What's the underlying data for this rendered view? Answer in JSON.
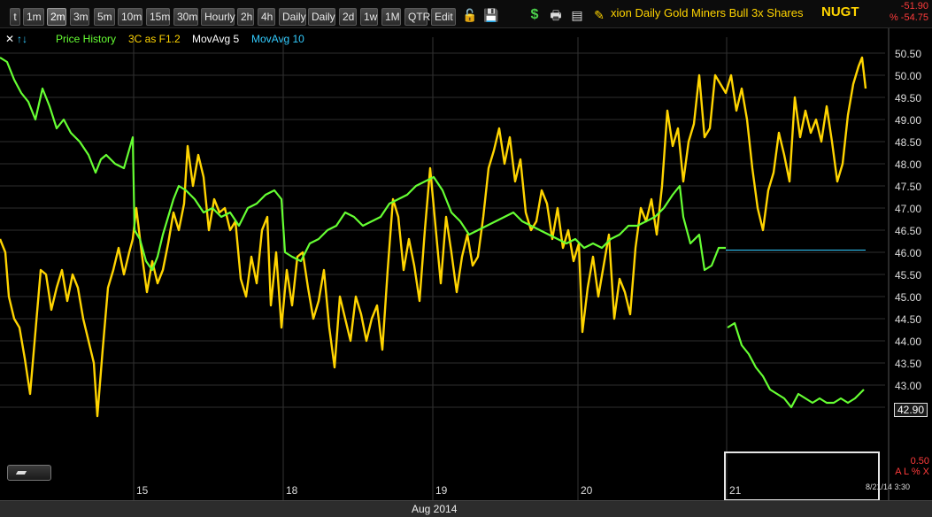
{
  "toolbar": {
    "buttons": [
      "t",
      "1m",
      "2m",
      "3m",
      "5m",
      "10m",
      "15m",
      "30m",
      "Hourly",
      "2h",
      "4h",
      "Daily",
      "Daily",
      "2d",
      "1w",
      "1M",
      "QTR",
      "Edit"
    ],
    "active": "2m",
    "icons": [
      "lock-icon",
      "save-icon",
      "dollar-icon",
      "print-icon",
      "data-window-icon",
      "pencil-icon"
    ],
    "title": "xion Daily Gold Miners Bull 3x Shares",
    "symbol": "NUGT",
    "change_abs": "-51.90",
    "change_pct": "% -54.75"
  },
  "legend": {
    "arrows": "↑↓",
    "items": [
      "Price History",
      "3C as F1.2",
      "MovAvg 5",
      "MovAvg 10"
    ],
    "colors": [
      "#66ff33",
      "#ffd400",
      "#ffffff",
      "#33ccff"
    ]
  },
  "bottom": {
    "month_label": "Aug 2014",
    "timestamp": "8/21/14 3:30",
    "small_value": "0.50",
    "small_controls": "A L % X",
    "last_price": "42.90"
  },
  "chart_data": {
    "type": "line",
    "x_labels": [
      "15",
      "18",
      "19",
      "20",
      "21"
    ],
    "y_ticks": [
      50.5,
      50.0,
      49.5,
      49.0,
      48.5,
      48.0,
      47.5,
      47.0,
      46.5,
      46.0,
      45.5,
      45.0,
      44.5,
      44.0,
      43.5,
      43.0,
      42.5
    ],
    "ylim": [
      42.15,
      50.85
    ],
    "grid": true,
    "series": [
      {
        "name": "Price History",
        "color": "#66ff33",
        "points": [
          [
            0,
            50.4
          ],
          [
            8,
            50.3
          ],
          [
            16,
            49.9
          ],
          [
            24,
            49.6
          ],
          [
            32,
            49.4
          ],
          [
            40,
            49.0
          ],
          [
            48,
            49.7
          ],
          [
            56,
            49.3
          ],
          [
            64,
            48.8
          ],
          [
            72,
            49.0
          ],
          [
            80,
            48.7
          ],
          [
            90,
            48.5
          ],
          [
            100,
            48.2
          ],
          [
            108,
            47.8
          ],
          [
            114,
            48.1
          ],
          [
            120,
            48.2
          ],
          [
            130,
            48.0
          ],
          [
            140,
            47.9
          ],
          [
            150,
            48.6
          ],
          [
            152,
            46.5
          ],
          [
            158,
            46.3
          ],
          [
            165,
            45.8
          ],
          [
            172,
            45.6
          ],
          [
            178,
            45.9
          ],
          [
            184,
            46.4
          ],
          [
            190,
            46.8
          ],
          [
            196,
            47.2
          ],
          [
            202,
            47.5
          ],
          [
            210,
            47.4
          ],
          [
            220,
            47.2
          ],
          [
            230,
            46.9
          ],
          [
            240,
            47.0
          ],
          [
            250,
            46.8
          ],
          [
            260,
            46.9
          ],
          [
            270,
            46.6
          ],
          [
            280,
            47.0
          ],
          [
            290,
            47.1
          ],
          [
            300,
            47.3
          ],
          [
            310,
            47.4
          ],
          [
            318,
            47.2
          ],
          [
            322,
            46.0
          ],
          [
            330,
            45.9
          ],
          [
            340,
            45.8
          ],
          [
            350,
            46.2
          ],
          [
            360,
            46.3
          ],
          [
            370,
            46.5
          ],
          [
            380,
            46.6
          ],
          [
            390,
            46.9
          ],
          [
            400,
            46.8
          ],
          [
            410,
            46.6
          ],
          [
            420,
            46.7
          ],
          [
            430,
            46.8
          ],
          [
            440,
            47.1
          ],
          [
            450,
            47.2
          ],
          [
            460,
            47.3
          ],
          [
            470,
            47.5
          ],
          [
            480,
            47.6
          ],
          [
            490,
            47.7
          ],
          [
            500,
            47.4
          ],
          [
            510,
            46.9
          ],
          [
            520,
            46.7
          ],
          [
            530,
            46.4
          ],
          [
            540,
            46.5
          ],
          [
            550,
            46.6
          ],
          [
            560,
            46.7
          ],
          [
            570,
            46.8
          ],
          [
            580,
            46.9
          ],
          [
            590,
            46.7
          ],
          [
            600,
            46.6
          ],
          [
            610,
            46.5
          ],
          [
            620,
            46.4
          ],
          [
            630,
            46.3
          ],
          [
            640,
            46.2
          ],
          [
            650,
            46.3
          ],
          [
            660,
            46.1
          ],
          [
            670,
            46.2
          ],
          [
            680,
            46.1
          ],
          [
            690,
            46.3
          ],
          [
            700,
            46.4
          ],
          [
            710,
            46.6
          ],
          [
            720,
            46.6
          ],
          [
            730,
            46.7
          ],
          [
            740,
            46.8
          ],
          [
            750,
            47.0
          ],
          [
            760,
            47.3
          ],
          [
            768,
            47.5
          ],
          [
            772,
            46.8
          ],
          [
            780,
            46.2
          ],
          [
            790,
            46.4
          ],
          [
            796,
            45.6
          ],
          [
            804,
            45.7
          ],
          [
            812,
            46.1
          ],
          [
            820,
            46.1
          ],
          [
            822,
            44.3
          ],
          [
            830,
            44.4
          ],
          [
            838,
            43.9
          ],
          [
            846,
            43.7
          ],
          [
            854,
            43.4
          ],
          [
            862,
            43.2
          ],
          [
            870,
            42.9
          ],
          [
            878,
            42.8
          ],
          [
            886,
            42.7
          ],
          [
            894,
            42.5
          ],
          [
            902,
            42.8
          ],
          [
            910,
            42.7
          ],
          [
            918,
            42.6
          ],
          [
            926,
            42.7
          ],
          [
            934,
            42.6
          ],
          [
            942,
            42.6
          ],
          [
            950,
            42.7
          ],
          [
            958,
            42.6
          ],
          [
            966,
            42.7
          ],
          [
            976,
            42.9
          ]
        ]
      },
      {
        "name": "3C as F1.2",
        "color": "#ffd400",
        "points": [
          [
            0,
            46.3
          ],
          [
            6,
            46.0
          ],
          [
            10,
            45.0
          ],
          [
            16,
            44.5
          ],
          [
            22,
            44.3
          ],
          [
            28,
            43.6
          ],
          [
            34,
            42.8
          ],
          [
            40,
            44.2
          ],
          [
            46,
            45.6
          ],
          [
            52,
            45.5
          ],
          [
            58,
            44.7
          ],
          [
            64,
            45.2
          ],
          [
            70,
            45.6
          ],
          [
            76,
            44.9
          ],
          [
            82,
            45.5
          ],
          [
            88,
            45.2
          ],
          [
            94,
            44.5
          ],
          [
            100,
            44.0
          ],
          [
            106,
            43.5
          ],
          [
            110,
            42.3
          ],
          [
            116,
            43.8
          ],
          [
            122,
            45.2
          ],
          [
            128,
            45.6
          ],
          [
            134,
            46.1
          ],
          [
            140,
            45.5
          ],
          [
            146,
            46.0
          ],
          [
            150,
            46.3
          ],
          [
            154,
            47.0
          ],
          [
            160,
            46.0
          ],
          [
            166,
            45.1
          ],
          [
            172,
            45.8
          ],
          [
            178,
            45.3
          ],
          [
            184,
            45.6
          ],
          [
            190,
            46.2
          ],
          [
            196,
            46.9
          ],
          [
            202,
            46.5
          ],
          [
            208,
            47.1
          ],
          [
            212,
            48.4
          ],
          [
            218,
            47.5
          ],
          [
            224,
            48.2
          ],
          [
            230,
            47.7
          ],
          [
            236,
            46.5
          ],
          [
            242,
            47.2
          ],
          [
            248,
            46.9
          ],
          [
            254,
            47.0
          ],
          [
            260,
            46.5
          ],
          [
            266,
            46.7
          ],
          [
            272,
            45.4
          ],
          [
            278,
            45.0
          ],
          [
            284,
            45.9
          ],
          [
            290,
            45.3
          ],
          [
            296,
            46.5
          ],
          [
            302,
            46.8
          ],
          [
            306,
            44.8
          ],
          [
            312,
            46.0
          ],
          [
            318,
            44.3
          ],
          [
            324,
            45.6
          ],
          [
            330,
            44.8
          ],
          [
            336,
            45.9
          ],
          [
            342,
            46.0
          ],
          [
            348,
            45.2
          ],
          [
            354,
            44.5
          ],
          [
            360,
            44.9
          ],
          [
            366,
            45.6
          ],
          [
            372,
            44.3
          ],
          [
            378,
            43.4
          ],
          [
            384,
            45.0
          ],
          [
            390,
            44.5
          ],
          [
            396,
            44.0
          ],
          [
            402,
            45.0
          ],
          [
            408,
            44.6
          ],
          [
            414,
            44.0
          ],
          [
            420,
            44.5
          ],
          [
            426,
            44.8
          ],
          [
            432,
            43.8
          ],
          [
            438,
            45.6
          ],
          [
            444,
            47.2
          ],
          [
            450,
            46.8
          ],
          [
            456,
            45.6
          ],
          [
            462,
            46.3
          ],
          [
            468,
            45.7
          ],
          [
            474,
            44.9
          ],
          [
            480,
            46.5
          ],
          [
            486,
            47.9
          ],
          [
            492,
            46.6
          ],
          [
            498,
            45.3
          ],
          [
            504,
            46.8
          ],
          [
            510,
            46.0
          ],
          [
            516,
            45.1
          ],
          [
            522,
            45.9
          ],
          [
            528,
            46.4
          ],
          [
            534,
            45.7
          ],
          [
            540,
            45.9
          ],
          [
            546,
            46.8
          ],
          [
            552,
            47.9
          ],
          [
            558,
            48.3
          ],
          [
            564,
            48.8
          ],
          [
            570,
            48.0
          ],
          [
            576,
            48.6
          ],
          [
            582,
            47.6
          ],
          [
            588,
            48.1
          ],
          [
            594,
            46.9
          ],
          [
            600,
            46.5
          ],
          [
            606,
            46.7
          ],
          [
            612,
            47.4
          ],
          [
            618,
            47.1
          ],
          [
            624,
            46.3
          ],
          [
            630,
            47.0
          ],
          [
            636,
            46.1
          ],
          [
            642,
            46.5
          ],
          [
            648,
            45.8
          ],
          [
            654,
            46.2
          ],
          [
            658,
            44.2
          ],
          [
            664,
            45.2
          ],
          [
            670,
            45.9
          ],
          [
            676,
            45.0
          ],
          [
            682,
            45.7
          ],
          [
            688,
            46.4
          ],
          [
            694,
            44.5
          ],
          [
            700,
            45.4
          ],
          [
            706,
            45.1
          ],
          [
            712,
            44.6
          ],
          [
            718,
            46.1
          ],
          [
            724,
            47.0
          ],
          [
            730,
            46.7
          ],
          [
            736,
            47.2
          ],
          [
            742,
            46.4
          ],
          [
            748,
            47.5
          ],
          [
            754,
            49.2
          ],
          [
            760,
            48.4
          ],
          [
            766,
            48.8
          ],
          [
            772,
            47.6
          ],
          [
            778,
            48.5
          ],
          [
            784,
            48.9
          ],
          [
            790,
            50.0
          ],
          [
            796,
            48.6
          ],
          [
            802,
            48.8
          ],
          [
            808,
            50.0
          ],
          [
            814,
            49.8
          ],
          [
            820,
            49.6
          ],
          [
            826,
            50.0
          ],
          [
            832,
            49.2
          ],
          [
            838,
            49.7
          ],
          [
            844,
            49.0
          ],
          [
            850,
            47.9
          ],
          [
            856,
            47.0
          ],
          [
            862,
            46.5
          ],
          [
            868,
            47.4
          ],
          [
            874,
            47.8
          ],
          [
            880,
            48.7
          ],
          [
            886,
            48.2
          ],
          [
            892,
            47.6
          ],
          [
            898,
            49.5
          ],
          [
            904,
            48.6
          ],
          [
            910,
            49.2
          ],
          [
            916,
            48.7
          ],
          [
            922,
            49.0
          ],
          [
            928,
            48.5
          ],
          [
            934,
            49.3
          ],
          [
            940,
            48.5
          ],
          [
            946,
            47.6
          ],
          [
            952,
            48.0
          ],
          [
            958,
            49.1
          ],
          [
            964,
            49.8
          ],
          [
            970,
            50.2
          ],
          [
            974,
            50.4
          ],
          [
            978,
            49.7
          ]
        ]
      },
      {
        "name": "MovAvg 10",
        "color": "#33ccff",
        "points": [
          [
            820,
            46.05
          ],
          [
            978,
            46.05
          ]
        ]
      }
    ]
  }
}
